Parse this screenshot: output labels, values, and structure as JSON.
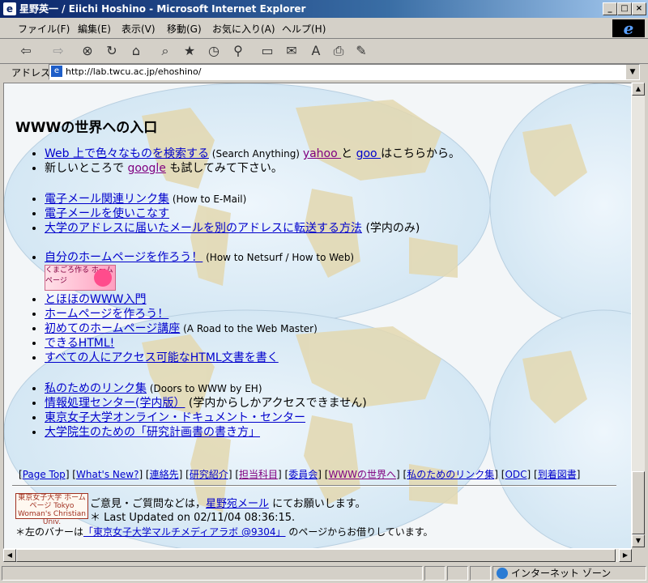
{
  "window": {
    "title": "星野英一 / Eiichi Hoshino - Microsoft Internet Explorer",
    "icon": "ie-page-icon"
  },
  "menu": [
    "ファイル(F)",
    "編集(E)",
    "表示(V)",
    "移動(G)",
    "お気に入り(A)",
    "ヘルプ(H)"
  ],
  "toolbar": {
    "buttons": [
      "back-icon",
      "forward-icon",
      "stop-icon",
      "refresh-icon",
      "home-icon",
      "search-icon",
      "favorites-icon",
      "history-icon",
      "channels-icon",
      "fullscreen-icon",
      "mail-icon",
      "font-icon",
      "print-icon",
      "edit-icon"
    ]
  },
  "address": {
    "label": "アドレス",
    "url": "http://lab.twcu.ac.jp/ehoshino/"
  },
  "page": {
    "heading": "WWWの世界への入口",
    "group1": {
      "l1_link": "Web 上で色々なものを検索する",
      "l1_text": " (Search Anything) ",
      "l1_yahoo": "yahoo ",
      "l1_and": " と ",
      "l1_goo": "goo ",
      "l1_tail": " はこちらから。",
      "l2_pre": "新しいところで ",
      "l2_google": "google",
      "l2_tail": " も試してみて下さい。"
    },
    "group2": {
      "l1_link": "電子メール関連リンク集",
      "l1_text": " (How to E-Mail)",
      "l2_link": "電子メールを使いこなす",
      "l3_link": "大学のアドレスに届いたメールを別のアドレスに転送する方法",
      "l3_text": " (学内のみ)"
    },
    "group3": {
      "l1_link": "自分のホームページを作ろう！",
      "l1_text": " (How to Netsurf / How to Web)",
      "banner_text": "くまごろ作る ホームページ",
      "l2_link": "とほほのWWW入門",
      "l3_link": "ホームページを作ろう！",
      "l4_link": "初めてのホームページ講座",
      "l4_text": " (A Road to the Web Master)",
      "l5_link": "できるHTML!",
      "l6_link": "すべての人にアクセス可能なHTML文書を書く"
    },
    "group4": {
      "l1_link": "私のためのリンク集",
      "l1_text": " (Doors to WWW by EH)",
      "l2_link": "情報処理センター(学内版）",
      "l2_text": " (学内からしかアクセスできません)",
      "l3_link": "東京女子大学オンライン・ドキュメント・センター",
      "l4_link": "大学院生のための「研究計画書の書き方」"
    },
    "nav": {
      "items": [
        "Page Top",
        "What's New?",
        "連絡先",
        "研究紹介",
        "担当科目",
        "委員会",
        "WWWの世界へ",
        "私のためのリンク集",
        "ODC",
        "到着図書"
      ]
    },
    "footer": {
      "logo_text": "東京女子大学 ホームページ Tokyo Woman's Christian Univ.",
      "line1_pre": "ご意見・ご質問などは，",
      "line1_link": "星野宛メール",
      "line1_tail": " にてお願いします。",
      "line2": "＊ Last Updated on 02/11/04 08:36:15.",
      "line3_pre": "＊左のバナーは",
      "line3_link": "「東京女子大学マルチメディアラボ @9304」",
      "line3_tail": " のページからお借りしています。"
    }
  },
  "status": {
    "zone": "インターネット ゾーン"
  },
  "colors": {
    "link": "#0000cc",
    "visited": "#800080",
    "titlebar": "#0a246a"
  }
}
